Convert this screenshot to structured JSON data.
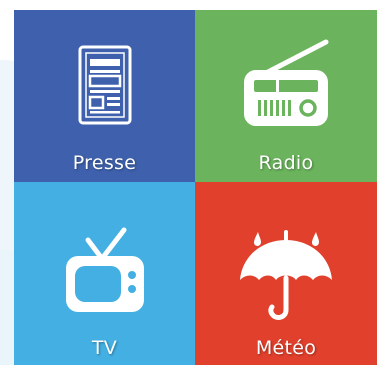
{
  "tiles": {
    "presse": {
      "label": "Presse",
      "icon": "newspaper-icon",
      "color": "#3f61ad"
    },
    "radio": {
      "label": "Radio",
      "icon": "radio-icon",
      "color": "#6bb45d"
    },
    "tv": {
      "label": "TV",
      "icon": "tv-icon",
      "color": "#43afe2"
    },
    "meteo": {
      "label": "Météo",
      "icon": "umbrella-icon",
      "color": "#e1402c"
    }
  }
}
